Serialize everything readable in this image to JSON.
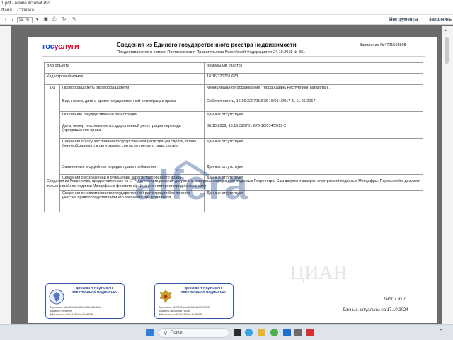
{
  "window": {
    "title": "1.pdf - Adobe Acrobat Pro"
  },
  "menu": {
    "items": [
      "Файл",
      "Справка"
    ]
  },
  "toolbar": {
    "zoom": "99,7%",
    "tools_label": "Инструменты",
    "fill_label": "Заполнить"
  },
  "document": {
    "logo_part1": "гос",
    "logo_part2": "услуги",
    "title": "Сведения из Единого государственного реестра недвижимости",
    "subtitle": "Предоставляются в рамках Постановления Правительства Российской Федерации от 24.10.2011 № 861",
    "statement_number": "Заявление №4721568898",
    "rows": [
      {
        "label": "Вид объекта",
        "value": "Земельный участок"
      },
      {
        "label": "Кадастровый номер",
        "value": "16:16:320701:673"
      }
    ],
    "section_number": "1.6",
    "section_rows": [
      {
        "label": "Правообладатель (правообладатели)",
        "value": "Муниципальное образование \"город Казань Республики Татарстан\","
      },
      {
        "label": "Вид, номер, дата и время государственной регистрации права",
        "value": "Собственность, 16:16:320701:673-16/014/2017-1, 11.05.2017"
      },
      {
        "label": "Основание государственной регистрации",
        "value": "Данные отсутствуют"
      },
      {
        "label": "Дата, номер и основание государственной регистрации перехода (прекращения) права",
        "value": "08.10.2019, 16:16:320701:673-16/014/2019-2"
      },
      {
        "label": "Сведения об осуществлении государственной регистрации сделки, права без необходимого в силу закона согласия третьего лица, органа",
        "value": "Данные отсутствуют"
      },
      {
        "label": "Заявленные в судебном порядке права требования",
        "value": "Данные отсутствуют"
      },
      {
        "label": "Сведения о возражении в отношении зарегистрированного права",
        "value": "Данные отсутствуют"
      },
      {
        "label": "Сведения о невозможности государственной регистрации без личного участия правообладателя или его законного представителя",
        "value": "Данные отсутствуют"
      }
    ],
    "footnote": "Сведения из Росреестра, предоставленные из ЕГРН для формирования документа, заверены электронной подписью Росреестра. Сам документ заверен электронной подписью Минцифры. Пересылайте документ только с файлом подписи Минцифры в формате sig. Иначе он потеряет юридическую силу",
    "stamps": [
      {
        "title": "ДОКУМЕНТ ПОДПИСАН ЭЛЕКТРОННОЙ ПОДПИСЬЮ",
        "cert": "Сертификат: fc8bd920e4f9a88e6e9f41a713bdfe5c",
        "owner": "Владелец: Росреестр",
        "valid": "Действителен: с 09.04.2024 по 29.06.2025"
      },
      {
        "title": "ДОКУМЕНТ ПОДПИСАН ЭЛЕКТРОННОЙ ПОДПИСЬЮ",
        "cert": "Сертификат: a01f97b2be8ca1b7621d4d2f0139331",
        "owner": "Владелец: Минцифры России",
        "valid": "Действителен: с 20.03.2024 по 13.06.2025"
      }
    ],
    "sheet": "Лист 7 из 7",
    "actual_date": "Данные актуальны на 17.10.2024"
  },
  "watermark": {
    "text": "alfera"
  },
  "taskbar": {
    "search_placeholder": "Поиск"
  },
  "colors": {
    "gos_blue": "#0d4cd3",
    "gos_red": "#e4002b",
    "stamp_blue": "#3657a8",
    "watermark": "#23468c"
  }
}
